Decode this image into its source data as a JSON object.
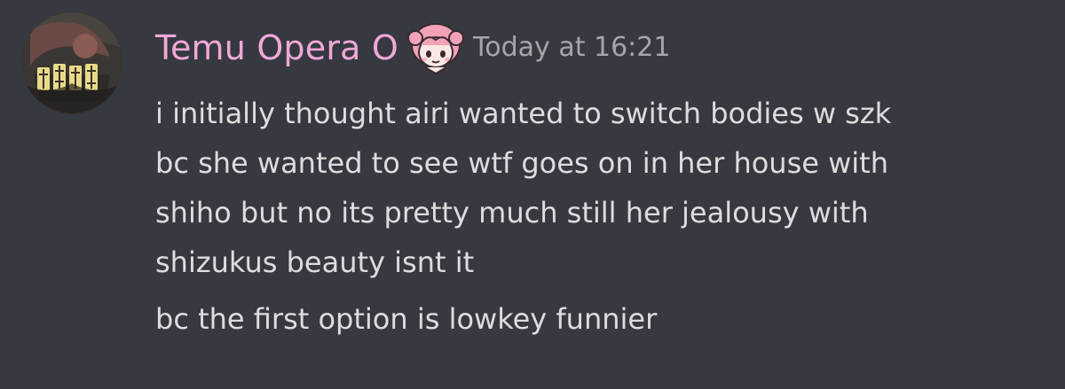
{
  "message": {
    "author": {
      "username": "Temu Opera O",
      "role_icon": "pink-haired-chibi-icon",
      "avatar_icon": "manga-avatar-icon",
      "username_color": "#f0a8d8"
    },
    "timestamp": "Today at 16:21",
    "lines": [
      "i initially thought airi wanted to switch bodies w szk",
      "bc she wanted to see wtf goes on in her house with",
      "shiho but no its pretty much still her jealousy with",
      "shizukus beauty isnt it",
      "bc the first option is lowkey funnier"
    ]
  },
  "colors": {
    "background": "#36393f",
    "text": "#dcddde",
    "timestamp": "#a3a6aa"
  }
}
